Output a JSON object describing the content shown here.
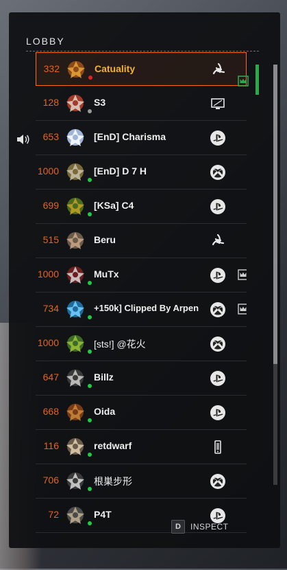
{
  "lobby": {
    "title": "LOBBY",
    "players": [
      {
        "level": "332",
        "name": "Catuality",
        "status": "red",
        "platform": "battlenet",
        "crown": true,
        "selected": true,
        "gold": true
      },
      {
        "level": "128",
        "name": "S3",
        "status": "gray",
        "platform": "pc"
      },
      {
        "level": "653",
        "name": "[EnD] Charisma",
        "status": "none",
        "platform": "playstation",
        "speaking": true
      },
      {
        "level": "1000",
        "name": "[EnD] D 7 H",
        "status": "green",
        "platform": "xbox"
      },
      {
        "level": "699",
        "name": "[KSa] C4",
        "status": "green",
        "platform": "playstation"
      },
      {
        "level": "515",
        "name": "Beru",
        "status": "none",
        "platform": "battlenet"
      },
      {
        "level": "1000",
        "name": "MuTx",
        "status": "green",
        "platform": "playstation",
        "crown": true
      },
      {
        "level": "734",
        "name": "+150k] Clipped By Arpen",
        "status": "green",
        "platform": "xbox",
        "crown": true
      },
      {
        "level": "1000",
        "name": "[sts!] @花火",
        "status": "green",
        "platform": "xbox",
        "light": true
      },
      {
        "level": "647",
        "name": "Billz",
        "status": "green",
        "platform": "playstation"
      },
      {
        "level": "668",
        "name": "Oida",
        "status": "green",
        "platform": "playstation"
      },
      {
        "level": "116",
        "name": "retdwarf",
        "status": "green",
        "platform": "mobile"
      },
      {
        "level": "706",
        "name": "根巣步形",
        "status": "green",
        "platform": "xbox",
        "light": true
      },
      {
        "level": "72",
        "name": "P4T",
        "status": "green",
        "platform": "playstation"
      }
    ]
  },
  "inspect": {
    "key": "D",
    "label": "INSPECT"
  },
  "colors": {
    "level": "#e8631b",
    "selected_border": "#ff6a16",
    "gold_name": "#f2b233",
    "online": "#1fcc47",
    "scrollbar": "#8a8b8e",
    "accent": "#2ea84c"
  }
}
